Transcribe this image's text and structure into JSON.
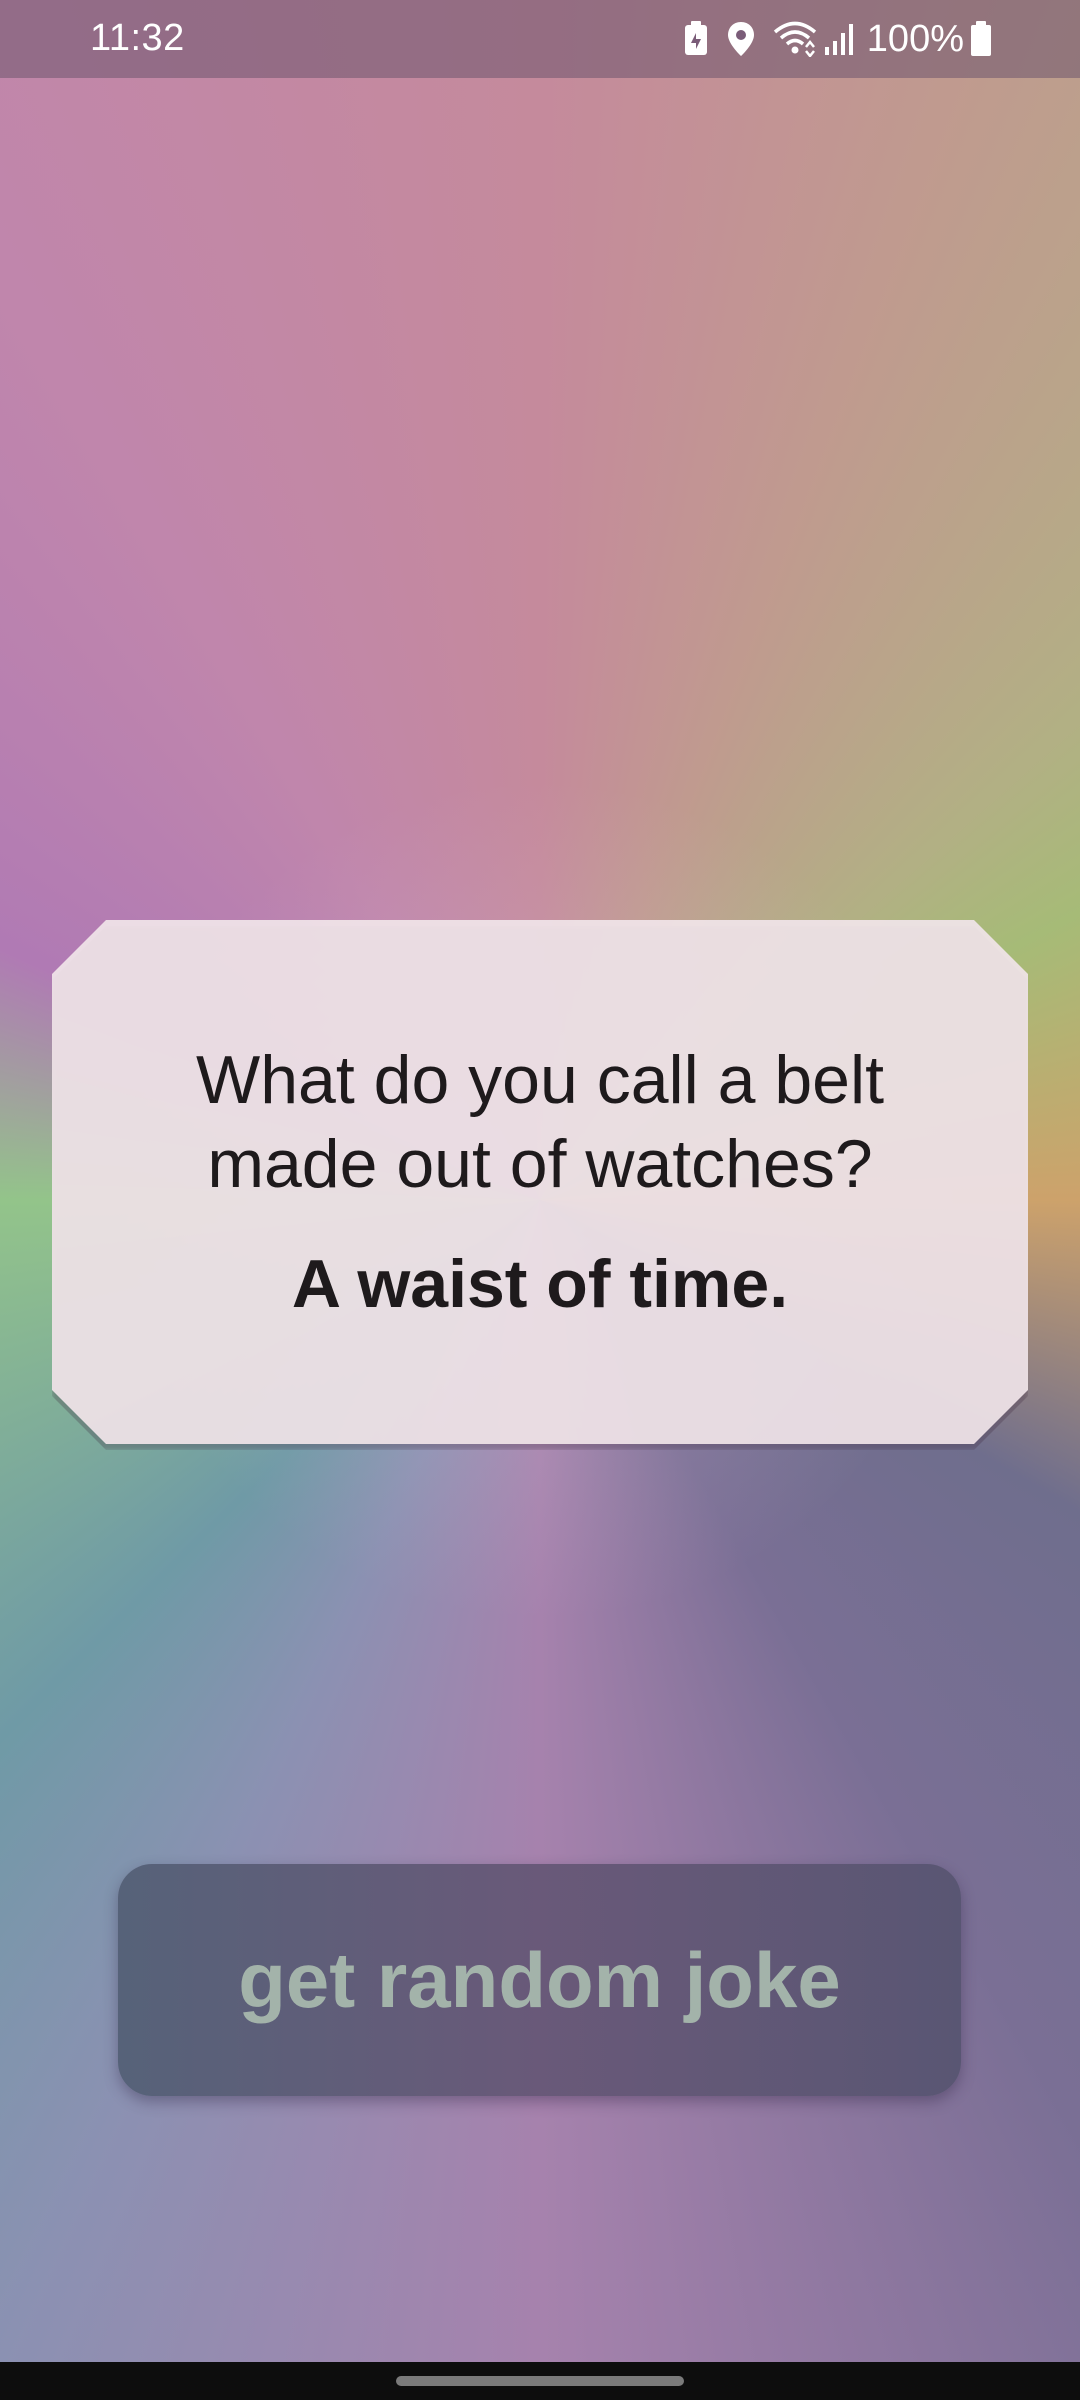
{
  "status_bar": {
    "time": "11:32",
    "battery_percent": "100%",
    "icons": [
      "battery-saver-icon",
      "location-icon",
      "wifi-icon",
      "signal-icon",
      "battery-icon"
    ]
  },
  "joke": {
    "setup": "What do you call a belt made out of watches?",
    "punchline": "A waist of time."
  },
  "button": {
    "label": "get random joke"
  },
  "colors": {
    "card_background": "#f0e4e8",
    "button_background": "#5e5a77",
    "button_text": "#a3b3aa",
    "text": "#1e1a1c"
  }
}
